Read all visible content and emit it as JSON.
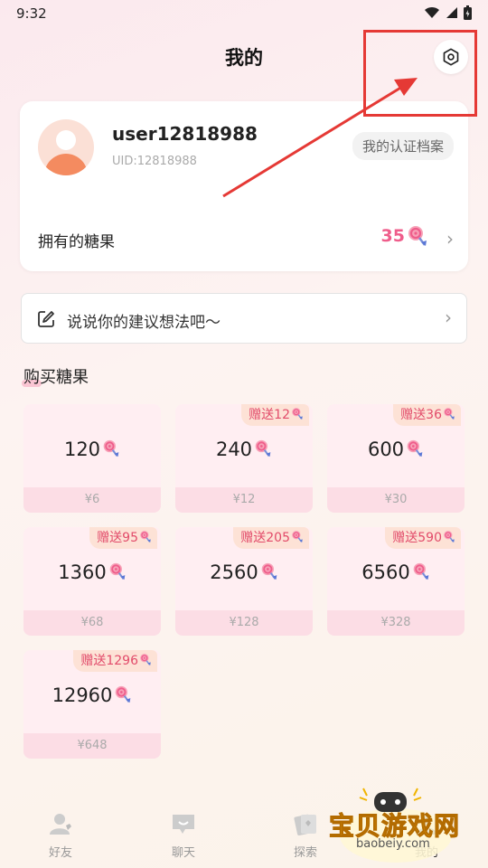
{
  "status_bar": {
    "time": "9:32"
  },
  "header": {
    "title": "我的"
  },
  "profile": {
    "username": "user12818988",
    "uid": "UID:12818988",
    "cert_button": "我的认证档案",
    "candy_label": "拥有的糖果",
    "candy_count": "35"
  },
  "suggestion": {
    "text": "说说你的建议想法吧～"
  },
  "purchase": {
    "title": "购买糖果",
    "packages": [
      {
        "amount": "120",
        "price": "¥6",
        "bonus": ""
      },
      {
        "amount": "240",
        "price": "¥12",
        "bonus": "赠送12"
      },
      {
        "amount": "600",
        "price": "¥30",
        "bonus": "赠送36"
      },
      {
        "amount": "1360",
        "price": "¥68",
        "bonus": "赠送95"
      },
      {
        "amount": "2560",
        "price": "¥128",
        "bonus": "赠送205"
      },
      {
        "amount": "6560",
        "price": "¥328",
        "bonus": "赠送590"
      },
      {
        "amount": "12960",
        "price": "¥648",
        "bonus": "赠送1296"
      }
    ]
  },
  "tabbar": {
    "items": [
      {
        "label": "好友",
        "icon": "friends-icon"
      },
      {
        "label": "聊天",
        "icon": "chat-icon"
      },
      {
        "label": "探索",
        "icon": "explore-icon"
      },
      {
        "label": "我的",
        "icon": "profile-icon"
      }
    ]
  },
  "watermark": {
    "text": "宝贝游戏网",
    "url": "baobeiy.com"
  },
  "colors": {
    "accent": "#ef5d8b",
    "annotation": "#e53935"
  }
}
